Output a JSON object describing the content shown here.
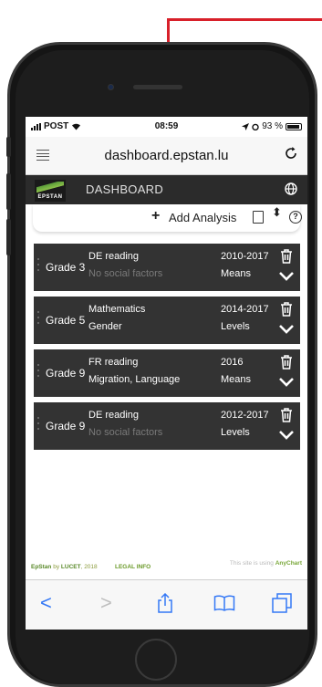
{
  "status_bar": {
    "carrier": "POST",
    "time": "08:59",
    "battery": "93 %"
  },
  "browser": {
    "url": "dashboard.epstan.lu",
    "back_glyph": "<",
    "forward_glyph": ">",
    "share_glyph": "⍐",
    "bookmarks_glyph": "⊓⊓",
    "tabs_glyph": "▢"
  },
  "app": {
    "logo_text": "EPSTAN",
    "title": "DASHBOARD",
    "add_plus": "+",
    "add_label": "Add Analysis",
    "sort_glyph": "⬍",
    "help_glyph": "?"
  },
  "analyses": [
    {
      "grade": "Grade 3",
      "subject": "DE reading",
      "factor": "No social factors",
      "factor_muted": true,
      "years": "2010-2017",
      "measure": "Means"
    },
    {
      "grade": "Grade 5",
      "subject": "Mathematics",
      "factor": "Gender",
      "factor_muted": false,
      "years": "2014-2017",
      "measure": "Levels"
    },
    {
      "grade": "Grade 9",
      "subject": "FR reading",
      "factor": "Migration, Language",
      "factor_muted": false,
      "years": "2016",
      "measure": "Means"
    },
    {
      "grade": "Grade 9",
      "subject": "DE reading",
      "factor": "No social factors",
      "factor_muted": true,
      "years": "2012-2017",
      "measure": "Levels"
    }
  ],
  "footer": {
    "brand_prefix": "EpStan",
    "brand_by": "by",
    "brand_company": "LUCET",
    "brand_year": ", 2018",
    "legal": "LEGAL INFO",
    "anychart_prefix": "This site is using",
    "anychart_name": "AnyChart"
  },
  "colors": {
    "accent_red": "#d8202a",
    "card_bg": "#333333",
    "ios_blue": "#3478f6",
    "brand_green": "#6b9a2a"
  }
}
